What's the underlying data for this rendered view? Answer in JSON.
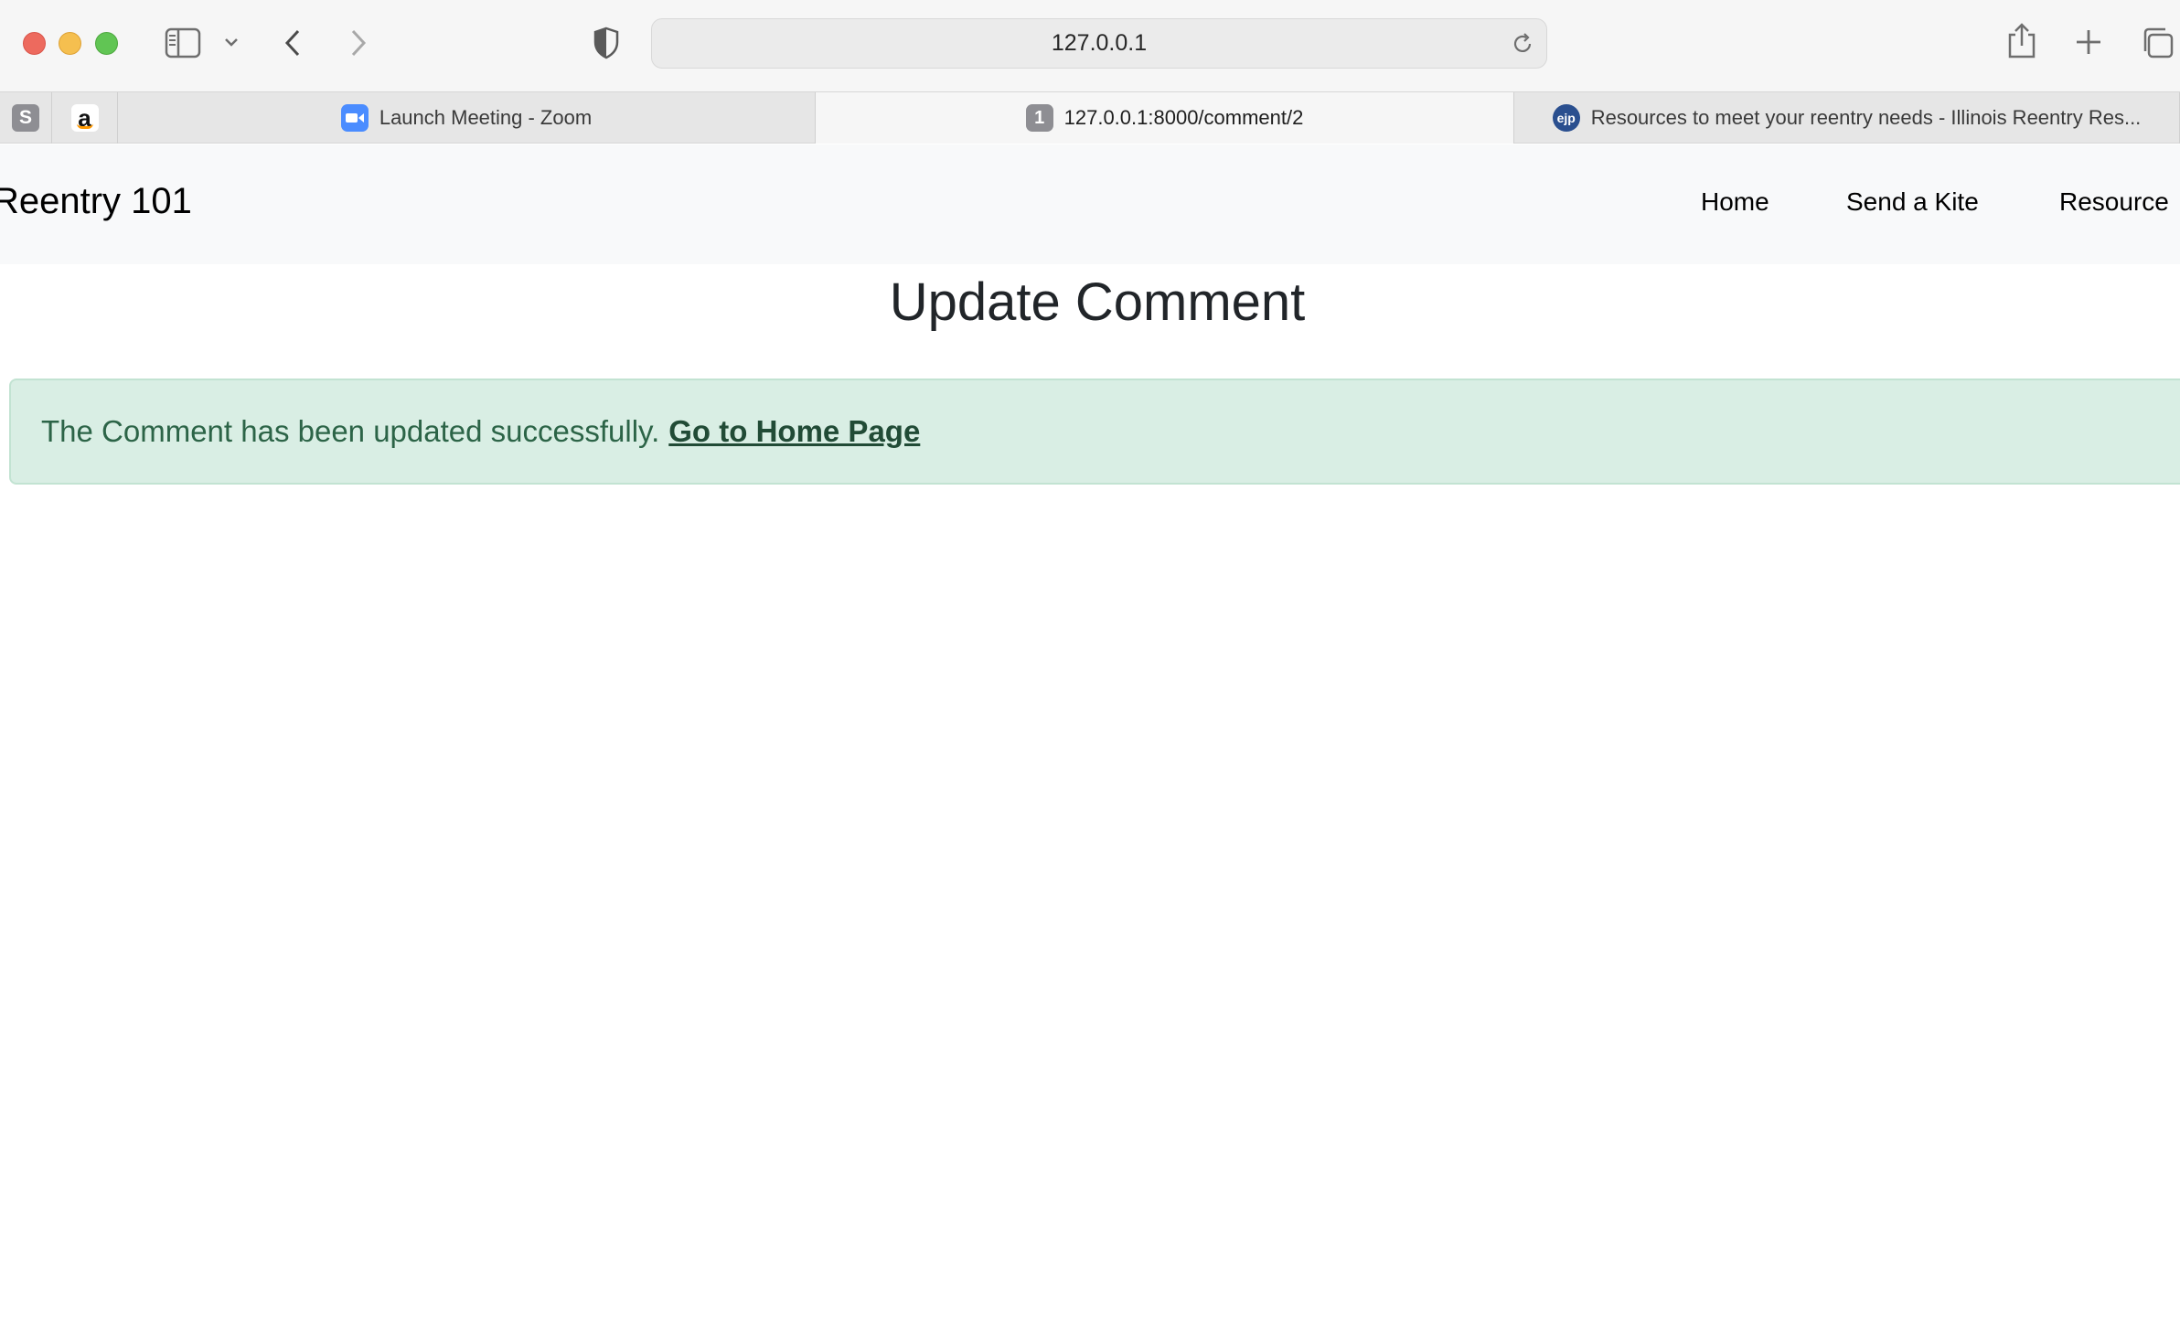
{
  "browser": {
    "address": "127.0.0.1",
    "tabs": [
      {
        "title": "Launch Meeting - Zoom",
        "favicon": "zoom-camera-icon",
        "active": false
      },
      {
        "title": "127.0.0.1:8000/comment/2",
        "favicon_text": "1",
        "active": true
      },
      {
        "title": "Resources to meet your reentry needs - Illinois Reentry Res...",
        "favicon_text": "ejp",
        "active": false
      }
    ],
    "pinned": [
      {
        "icon": "s-pinned-icon",
        "text": "S"
      },
      {
        "icon": "amazon-icon",
        "text": "a"
      }
    ]
  },
  "site": {
    "brand": "Reentry 101",
    "nav": [
      {
        "label": "Home"
      },
      {
        "label": "Send a Kite"
      },
      {
        "label": "Resource"
      }
    ]
  },
  "main": {
    "heading": "Update Comment",
    "alert": {
      "message": "The Comment has been updated successfully.",
      "link": "Go to Home Page"
    }
  },
  "colors": {
    "alert_bg": "#d9eee4",
    "alert_text": "#2c6447",
    "navbar_bg": "#f8f9fa"
  }
}
